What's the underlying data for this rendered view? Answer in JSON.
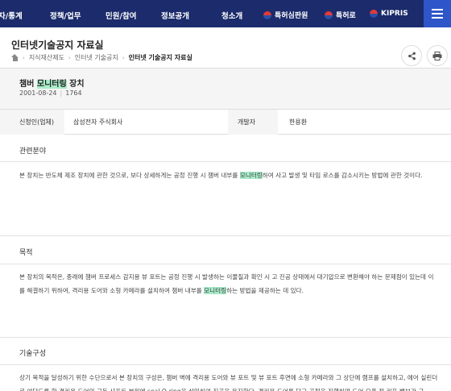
{
  "nav": {
    "items": [
      "자/통계",
      "정책/업무",
      "민원/참여",
      "정보공개",
      "청소개"
    ],
    "ext": [
      "특허심판원",
      "특허로",
      "KIPRIS"
    ]
  },
  "page": {
    "title": "인터넷기술공지 자료실",
    "breadcrumb": [
      "지식재산제도",
      "인터넷 기술공지",
      "인터넷 기술공지 자료실"
    ]
  },
  "doc": {
    "title_pre": "챔버 ",
    "title_hl": "모니터링",
    "title_post": " 장치",
    "date": "2001-08-24",
    "number": "1764"
  },
  "info": {
    "applicant_label": "신청인(업체)",
    "applicant": "삼성전자 주식회사",
    "developer_label": "개발자",
    "developer": "한용환"
  },
  "sections": {
    "field_title": "관련분야",
    "field_pre": "본 장치는 반도체 제조 장치에 관한 것으로, 보다 상세하게는 공정 진행 시 챔버 내부를 ",
    "field_hl": "모니터링",
    "field_post": "하여 사고 발생 및 타임 로스를 감소시키는 방법에 관한 것이다.",
    "purpose_title": "목적",
    "purpose_pre": "본 장치의 목적은, 종래에 챔버 프로세스 감지용 뷰 포트는 공정 진행 시 발생하는 이물질과 확인 시 고 진공 상태에서 대기압으로 변환해야 하는 문제점이 있는데 이를 해결하기 위하여, 격리용 도어와 소형 카메라를 설치하여 챔버 내부를 ",
    "purpose_hl": "모니터링",
    "purpose_post": "하는 방법을 제공하는 데 있다.",
    "config_title": "기술구성",
    "config_text": "상기 목적을 달성하기 위한 수단으로서 본 장치의 구성은, 챔버 벽에 격리용 도어와 뷰 포트 및 뷰 포트 후면에 소형 카메라와 그 상단에 램프를 설치하고, 에어 실린더로 여닫도록 한 격리용 도어의 구동 샤프트 부위에 seal O-ring을 삽입하여 진공을 유지한다. 격리용 도어를 닫고 공정을 진행하며 도어 오픈 전 리프 밸브가 구"
  }
}
